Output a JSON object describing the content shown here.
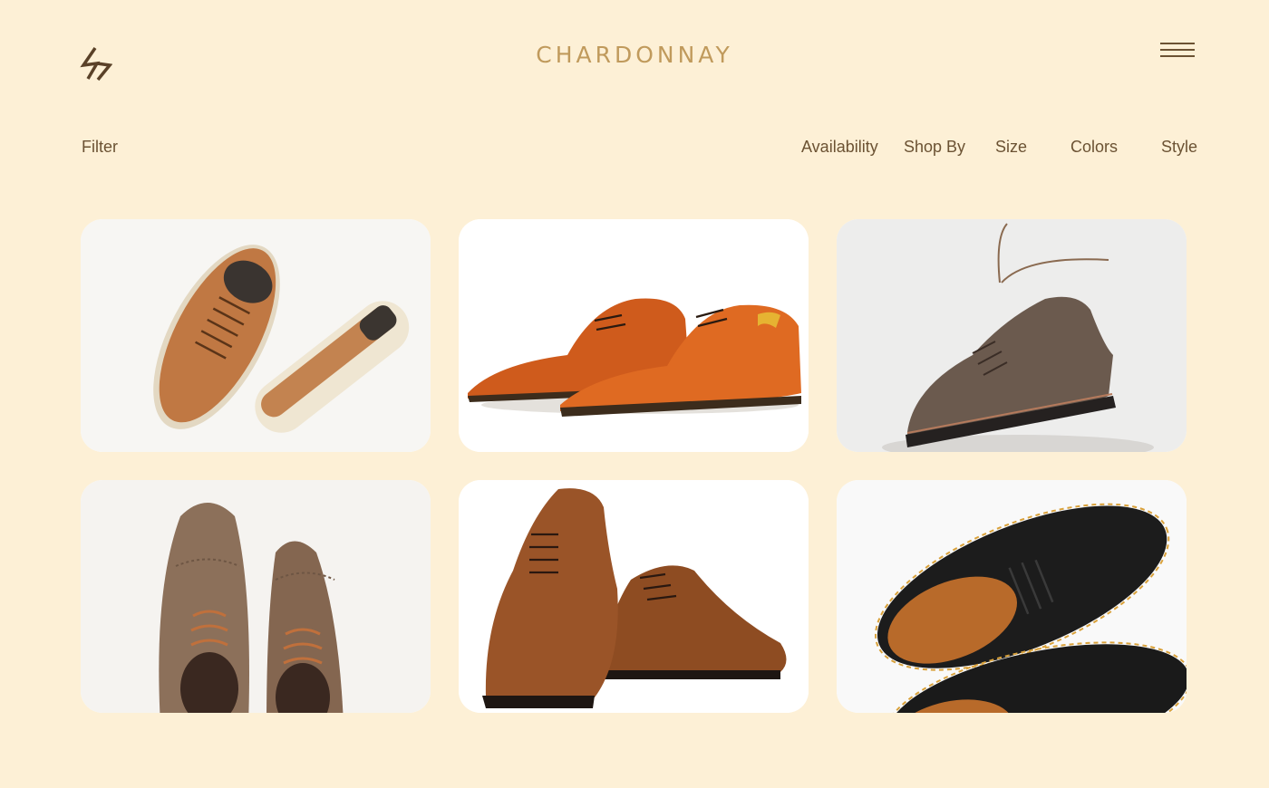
{
  "header": {
    "brand": "CHARDONNAY",
    "logo_icon": "lightning-bolt-icon",
    "menu_icon": "hamburger-menu-icon"
  },
  "toolbar": {
    "filter_label": "Filter",
    "filters": [
      "Availability",
      "Shop By",
      "Size",
      "Colors",
      "Style"
    ]
  },
  "products": [
    {
      "name": "tan-suede-sneakers",
      "color": "#b86e3c",
      "sole": "#e9e0cc"
    },
    {
      "name": "orange-leather-oxfords",
      "color": "#d86420",
      "sole": "#3a2c1c"
    },
    {
      "name": "brown-suede-brogue",
      "color": "#6b5a4e",
      "sole": "#2a2420"
    },
    {
      "name": "taupe-suede-brogues",
      "color": "#8a6e58",
      "sole": "#5b4536"
    },
    {
      "name": "brown-cap-toe-oxfords",
      "color": "#9a5428",
      "sole": "#1e1612"
    },
    {
      "name": "black-leather-derbies",
      "color": "#1c1c1c",
      "sole": "#d9a13a"
    }
  ],
  "colors": {
    "background": "#fdf0d6",
    "brand": "#c09a5c",
    "text": "#6b5233"
  }
}
